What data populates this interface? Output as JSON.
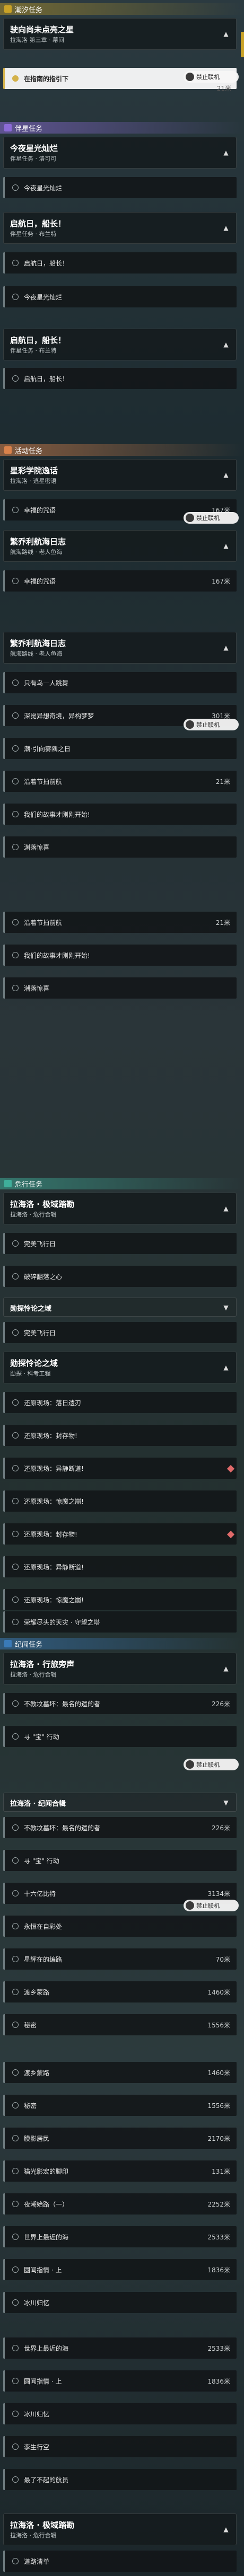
{
  "colors": {
    "tide": "#c9a227",
    "companion": "#8c6bd6",
    "event": "#d9824b",
    "danger": "#3fae9a",
    "faction": "#3a7ab8"
  },
  "sections": {
    "tide": "潮汐任务",
    "companion": "伴星任务",
    "event": "活动任务",
    "danger": "危行任务",
    "faction": "纪闻任务"
  },
  "cards": [
    {
      "title": "驶向尚未点亮之星",
      "sub": "拉海洛 第三章 · 幕间"
    },
    {
      "title": "今夜星光灿烂",
      "sub": "伴星任务 · 洛可可"
    },
    {
      "title": "启航日，船长！",
      "sub": "伴星任务 · 布兰特"
    },
    {
      "title": "启航日，船长！",
      "sub": "伴星任务 · 布兰特"
    },
    {
      "title": "星彩学院逸话",
      "sub": "拉海洛 · 逃星密语"
    },
    {
      "title": "繁乔利航海日志",
      "sub": "航海路线 · 老人鱼海"
    },
    {
      "title": "繁乔利航海日志",
      "sub": "航海路线 · 老人鱼海"
    },
    {
      "title": "拉海洛 · 极域踏勘",
      "sub": "拉海洛 · 危行合辑"
    },
    {
      "title": "勋探怜论之域",
      "sub": "勋探 · 科考工程"
    },
    {
      "title": "拉海洛 · 行旅旁声",
      "sub": "拉海洛 · 危行合辑"
    },
    {
      "title": "拉海洛 · 极域踏勘",
      "sub": "拉海洛 · 危行合辑"
    }
  ],
  "rows": [
    {
      "label": "在指南的指引下",
      "dist": "21米"
    },
    {
      "label": "今夜星光灿烂",
      "dist": ""
    },
    {
      "label": "启航日，船长！",
      "dist": ""
    },
    {
      "label": "今夜星光灿烂",
      "dist": ""
    },
    {
      "label": "启航日，船长！",
      "dist": ""
    },
    {
      "label": "幸福的咒语",
      "dist": "167米"
    },
    {
      "label": "幸福的咒语",
      "dist": "167米"
    },
    {
      "label": "只有鸟一人跳舞",
      "dist": ""
    },
    {
      "label": "深觉异想奇境，异构梦梦",
      "dist": "301米"
    },
    {
      "label": "潮·引向雾隅之日",
      "dist": ""
    },
    {
      "label": "沿着节拍前航",
      "dist": "21米"
    },
    {
      "label": "我们的故事才刚刚开始!",
      "dist": ""
    },
    {
      "label": "渊落惊喜",
      "dist": ""
    },
    {
      "label": "沿着节拍前航",
      "dist": "21米"
    },
    {
      "label": "我们的故事才刚刚开始!",
      "dist": ""
    },
    {
      "label": "潮落惊喜",
      "dist": ""
    },
    {
      "label": "完美飞行日",
      "dist": ""
    },
    {
      "label": "破碎翻落之心",
      "dist": ""
    },
    {
      "label": "完美飞行日",
      "dist": ""
    },
    {
      "label": "破碎翻落之心",
      "dist": ""
    },
    {
      "label": "还原现场：落日遗刃",
      "dist": ""
    },
    {
      "label": "还原现场：封存物!",
      "dist": ""
    },
    {
      "label": "还原现场：异静断道!",
      "dist": ""
    },
    {
      "label": "还原现场：惊魔之崩!",
      "dist": ""
    },
    {
      "label": "还原现场：落日遗刃",
      "dist": ""
    },
    {
      "label": "还原现场：封存物!",
      "dist": ""
    },
    {
      "label": "还原现场：异静断道!",
      "dist": ""
    },
    {
      "label": "还原现场：惊魔之崩!",
      "dist": ""
    },
    {
      "label": "荣耀尽头的天灾 · 守望之塔",
      "dist": ""
    },
    {
      "label": "不教坟墓坏：最名的遗的者",
      "dist": "226米"
    },
    {
      "label": "寻 \"宝\" 行动",
      "dist": ""
    },
    {
      "label": "不教坟墓坏：最名的遗的者",
      "dist": "226米"
    },
    {
      "label": "寻 \"宝\" 行动",
      "dist": ""
    },
    {
      "label": "十六亿比特",
      "dist": "3134米"
    },
    {
      "label": "永恒在自彩处",
      "dist": ""
    },
    {
      "label": "星辉在的编路",
      "dist": "70米"
    },
    {
      "label": "渡乡蒙路",
      "dist": "1460米"
    },
    {
      "label": "秘密",
      "dist": "1556米"
    },
    {
      "label": "渡乡蒙路",
      "dist": "1460米"
    },
    {
      "label": "秘密",
      "dist": "1556米"
    },
    {
      "label": "膜影居民",
      "dist": "2170米"
    },
    {
      "label": "猫光影宏的脚印",
      "dist": "131米"
    },
    {
      "label": "夜潮始路（一）",
      "dist": "2252米"
    },
    {
      "label": "世界上最近的海",
      "dist": "2533米"
    },
    {
      "label": "圆闻指情 · 上",
      "dist": "1836米"
    },
    {
      "label": "冰川归忆",
      "dist": ""
    },
    {
      "label": "世界上最近的海",
      "dist": "2533米"
    },
    {
      "label": "圆闻指情 · 上",
      "dist": "1836米"
    },
    {
      "label": "冰川归忆",
      "dist": ""
    },
    {
      "label": "孪生行空",
      "dist": ""
    },
    {
      "label": "最了不起的航员",
      "dist": ""
    },
    {
      "label": "道路清单",
      "dist": ""
    }
  ],
  "badges": {
    "label": "禁止联机",
    "dist_a": "21米",
    "dist_b": "167米",
    "dist_c": "301米",
    "dist_d": "226米"
  },
  "group_labels": {
    "faction_group": "拉海洛 · 纪闻合辑",
    "danger_group": "勋探怜论之域"
  }
}
